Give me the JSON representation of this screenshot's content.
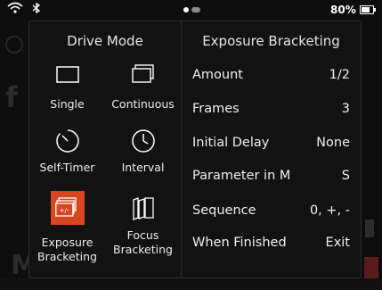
{
  "status": {
    "battery_percent": "80%",
    "colors": {
      "accent_orange": "#d8451f"
    }
  },
  "drive_mode": {
    "title": "Drive Mode",
    "modes": [
      {
        "id": "single",
        "label_lines": [
          "Single"
        ],
        "icon": "single-frame-icon",
        "selected": false
      },
      {
        "id": "continuous",
        "label_lines": [
          "Continuous"
        ],
        "icon": "continuous-frames-icon",
        "selected": false
      },
      {
        "id": "self_timer",
        "label_lines": [
          "Self-Timer"
        ],
        "icon": "self-timer-icon",
        "selected": false
      },
      {
        "id": "interval",
        "label_lines": [
          "Interval"
        ],
        "icon": "interval-clock-icon",
        "selected": false
      },
      {
        "id": "exposure_bracketing",
        "label_lines": [
          "Exposure",
          "Bracketing"
        ],
        "icon": "exposure-bracketing-icon",
        "selected": true
      },
      {
        "id": "focus_bracketing",
        "label_lines": [
          "Focus",
          "Bracketing"
        ],
        "icon": "focus-bracketing-icon",
        "selected": false
      }
    ]
  },
  "settings_panel": {
    "title": "Exposure Bracketing",
    "rows": [
      {
        "key": "Amount",
        "value": "1/2"
      },
      {
        "key": "Frames",
        "value": "3"
      },
      {
        "key": "Initial Delay",
        "value": "None"
      },
      {
        "key": "Parameter in M",
        "value": "S"
      },
      {
        "key": "Sequence",
        "value": "0, +, -"
      },
      {
        "key": "When Finished",
        "value": "Exit"
      }
    ]
  }
}
